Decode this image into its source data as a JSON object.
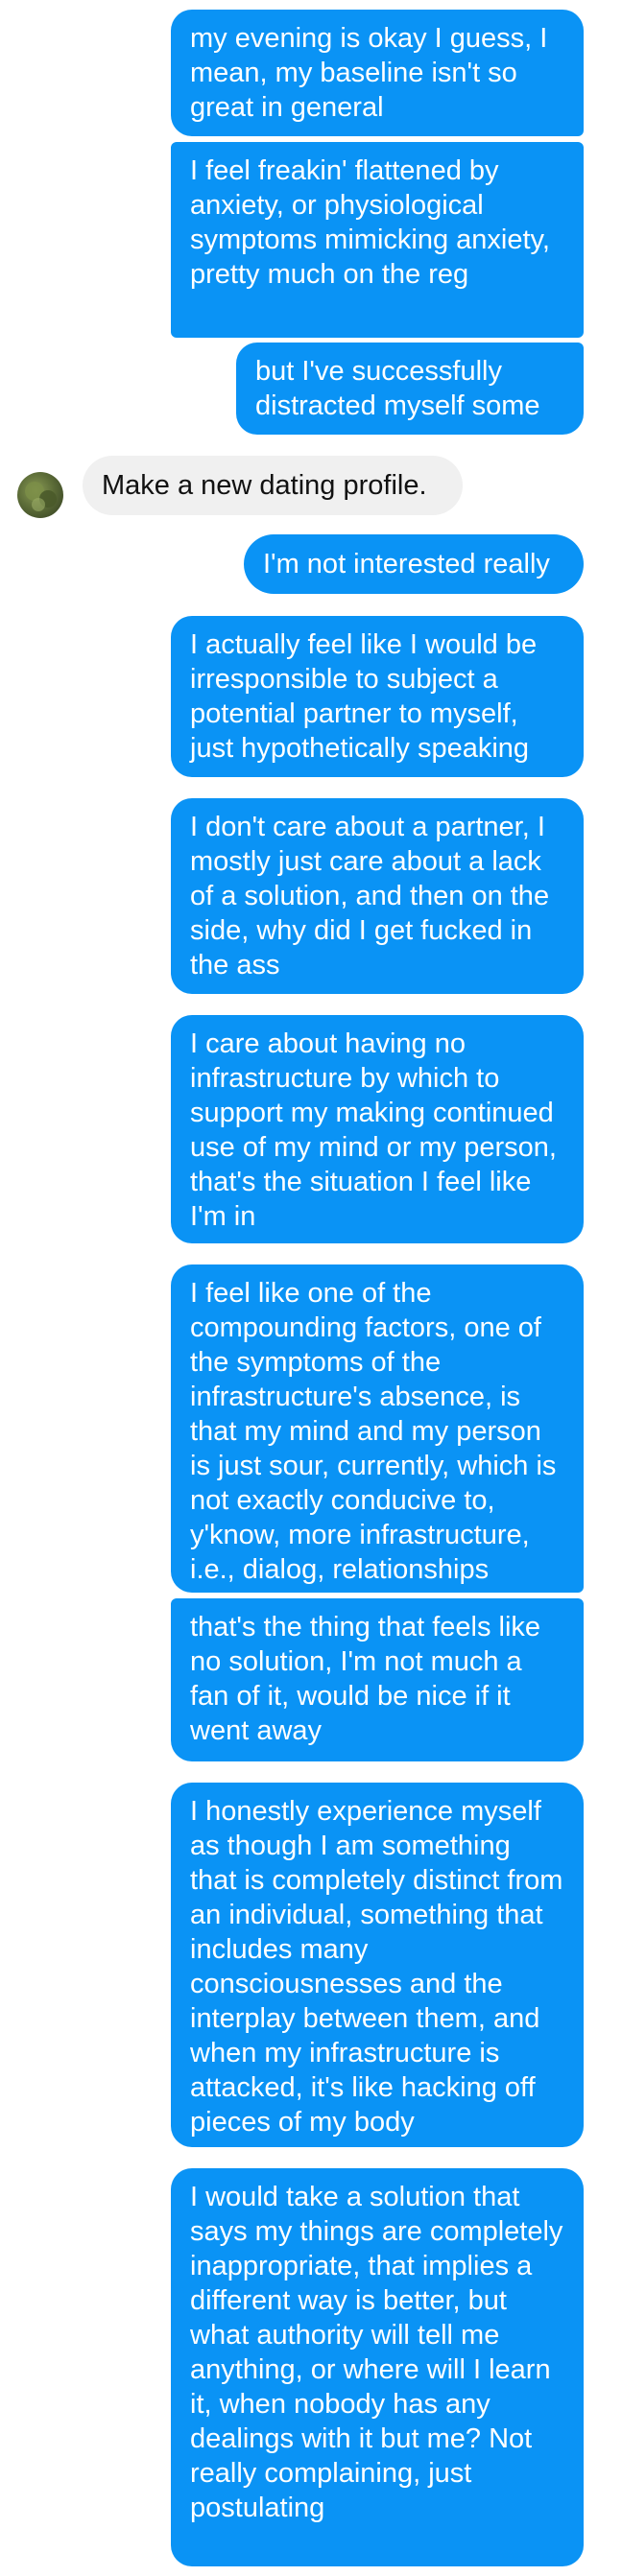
{
  "conversation": {
    "messages": [
      {
        "sender": "self",
        "text": "my evening is okay I guess, I mean, my baseline isn't so great in general"
      },
      {
        "sender": "self",
        "text": "I feel freakin' flattened by anxiety, or physiological symptoms mimicking anxiety, pretty much on the reg"
      },
      {
        "sender": "self",
        "text": "but I've successfully distracted myself some"
      },
      {
        "sender": "other",
        "text": "Make a new dating profile."
      },
      {
        "sender": "self",
        "text": "I'm not interested really"
      },
      {
        "sender": "self",
        "text": "I actually feel like I would be irresponsible to subject a potential partner to myself, just hypothetically speaking"
      },
      {
        "sender": "self",
        "text": "I don't care about a partner, I mostly just care about a lack of a solution, and then on the side, why did I get fucked in the ass"
      },
      {
        "sender": "self",
        "text": "I care about having no infrastructure by which to support my making continued use of my mind or my person, that's the situation I feel like I'm in"
      },
      {
        "sender": "self",
        "text": "I feel like one of the compounding factors, one of the symptoms of the infrastructure's absence, is that my mind and my person is just sour, currently, which is not exactly conducive to, y'know, more infrastructure, i.e., dialog, relationships"
      },
      {
        "sender": "self",
        "text": "that's the thing that feels like no solution, I'm not much a fan of it, would be nice if it went away"
      },
      {
        "sender": "self",
        "text": "I honestly experience myself as though I am something that is completely distinct from an individual, something that includes many consciousnesses and the interplay between them, and when my infrastructure is attacked, it's like hacking off pieces of my body"
      },
      {
        "sender": "self",
        "text": "I would take a solution that says my things are completely inappropriate, that implies a different way is better, but what authority will tell me anything, or where will I learn it, when nobody has any dealings with it but me? Not really complaining, just postulating"
      }
    ]
  },
  "colors": {
    "outgoing_bubble": "#0a93f5",
    "outgoing_text": "#ffffff",
    "incoming_bubble": "#f0f0f0",
    "incoming_text": "#111111"
  },
  "icons": {
    "contact_avatar": "avatar-icon"
  }
}
